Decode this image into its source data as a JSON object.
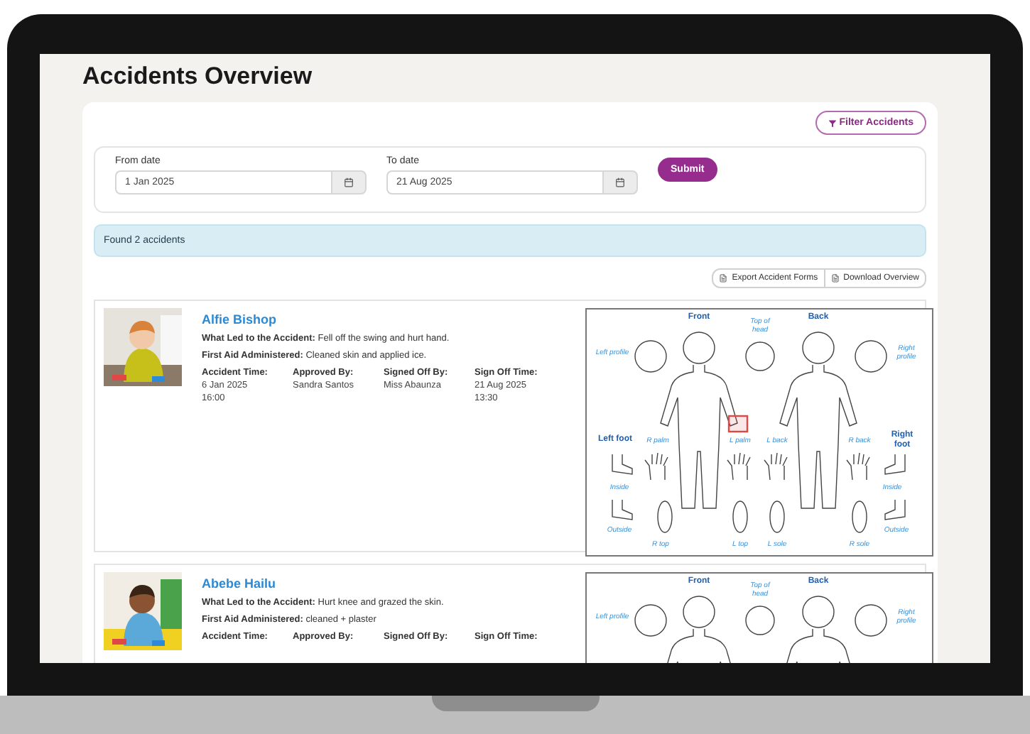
{
  "page_title": "Accidents Overview",
  "filter_button": "Filter Accidents",
  "date_fields": [
    {
      "label": "From date",
      "value": "1 Jan 2025"
    },
    {
      "label": "To date",
      "value": "21 Aug 2025"
    }
  ],
  "submit_button": "Submit",
  "result_message": "Found 2 accidents",
  "export_buttons": [
    "Export Accident Forms",
    "Download Overview"
  ],
  "accidents": [
    {
      "child_name": "Alfie Bishop",
      "what_led": "**What Led to the Accident:** Fell off the swing and hurt hand.",
      "first_aid": "**First Aid Administered:** Cleaned skin and applied ice.",
      "details": [
        {
          "label": "Accident Time:",
          "lines": [
            "6 Jan 2025",
            "16:00"
          ]
        },
        {
          "label": "Approved By:",
          "lines": [
            "Sandra Santos"
          ]
        },
        {
          "label": "Signed Off By:",
          "lines": [
            "Miss Abaunza"
          ]
        },
        {
          "label": "Sign Off Time:",
          "lines": [
            "21 Aug 2025",
            "13:30"
          ]
        }
      ],
      "injury_marked": true,
      "diagram_labels": [
        "Front",
        "Top of head",
        "Back",
        "Left profile",
        "Right profile",
        "Left foot",
        "R palm",
        "L palm",
        "L back",
        "R back",
        "Right foot",
        "Inside",
        "Inside",
        "Outside",
        "Outside",
        "R top",
        "L top",
        "L sole",
        "R sole"
      ]
    },
    {
      "child_name": "Abebe Hailu",
      "what_led": "**What Led to the Accident:** Hurt knee and grazed the skin.",
      "first_aid": "**First Aid Administered:** cleaned + plaster",
      "details": [
        {
          "label": "Accident Time:"
        },
        {
          "label": "Approved By:"
        },
        {
          "label": "Signed Off By:"
        },
        {
          "label": "Sign Off Time:"
        }
      ],
      "diagram_labels": [
        "Front",
        "Top of head",
        "Back",
        "Left profile",
        "Right profile"
      ]
    }
  ]
}
